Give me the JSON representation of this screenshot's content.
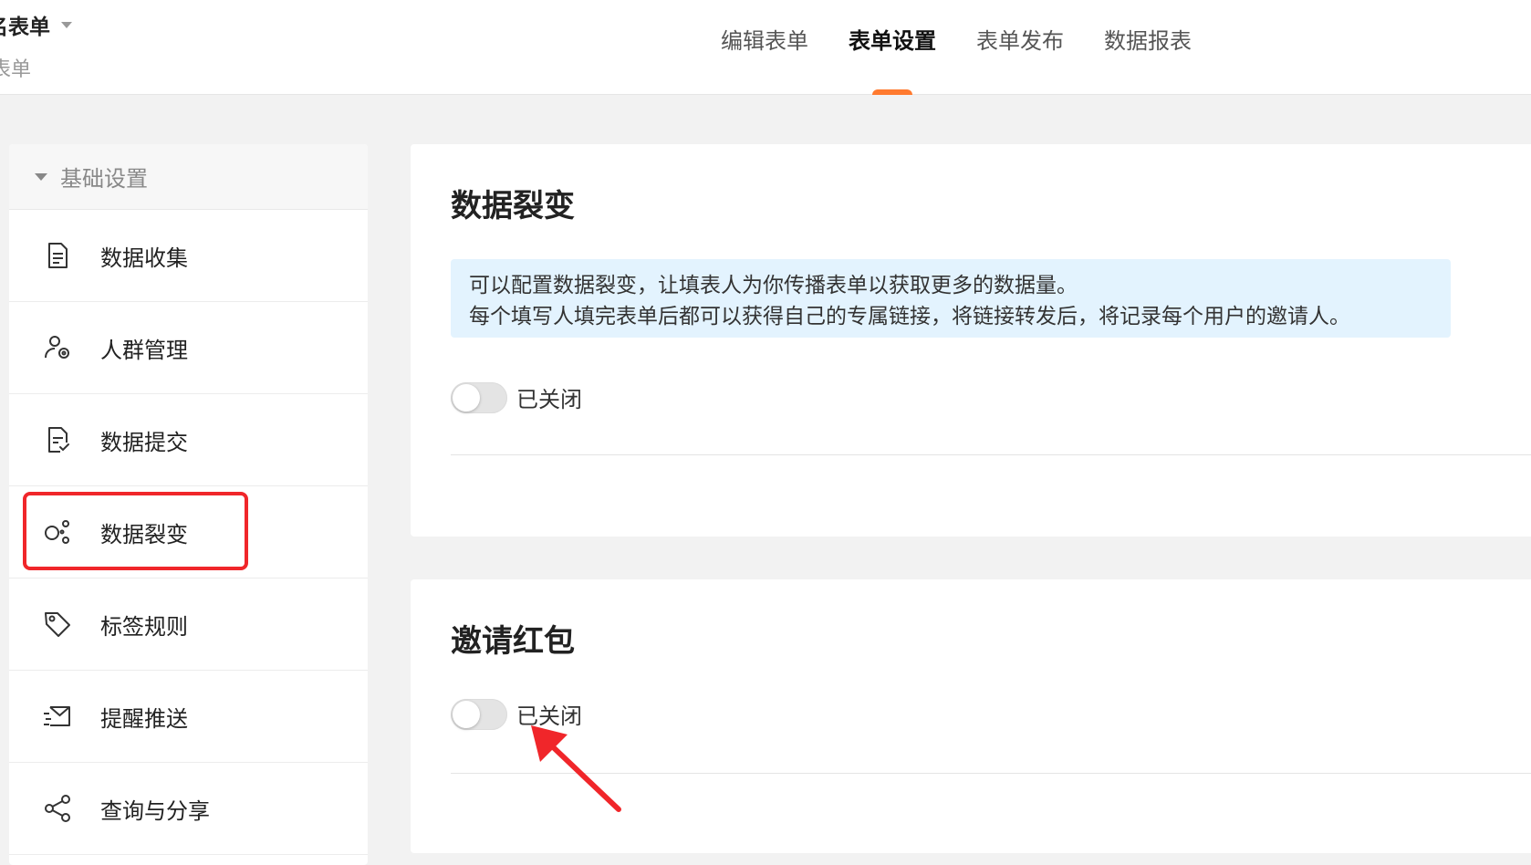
{
  "header": {
    "form_title": "名表单",
    "form_subtitle": "表单",
    "tabs": [
      {
        "label": "编辑表单",
        "active": false
      },
      {
        "label": "表单设置",
        "active": true
      },
      {
        "label": "表单发布",
        "active": false
      },
      {
        "label": "数据报表",
        "active": false
      }
    ],
    "accent_color": "#ff7a2f"
  },
  "sidebar": {
    "group_label": "基础设置",
    "items": [
      {
        "label": "数据收集",
        "icon": "document-icon"
      },
      {
        "label": "人群管理",
        "icon": "user-settings-icon"
      },
      {
        "label": "数据提交",
        "icon": "document-check-icon"
      },
      {
        "label": "数据裂变",
        "icon": "fission-icon",
        "highlighted": true
      },
      {
        "label": "标签规则",
        "icon": "tag-icon"
      },
      {
        "label": "提醒推送",
        "icon": "mail-send-icon"
      },
      {
        "label": "查询与分享",
        "icon": "share-icon"
      }
    ]
  },
  "panels": {
    "fission": {
      "title": "数据裂变",
      "notice_line1": "可以配置数据裂变，让填表人为你传播表单以获取更多的数据量。",
      "notice_line2": "每个填写人填完表单后都可以获得自己的专属链接，将链接转发后，将记录每个用户的邀请人。",
      "toggle_label": "已关闭",
      "enabled": false
    },
    "red_packet": {
      "title": "邀请红包",
      "toggle_label": "已关闭",
      "enabled": false
    }
  },
  "annotation_colors": {
    "highlight_box": "#f0262a",
    "arrow": "#f0262a"
  }
}
